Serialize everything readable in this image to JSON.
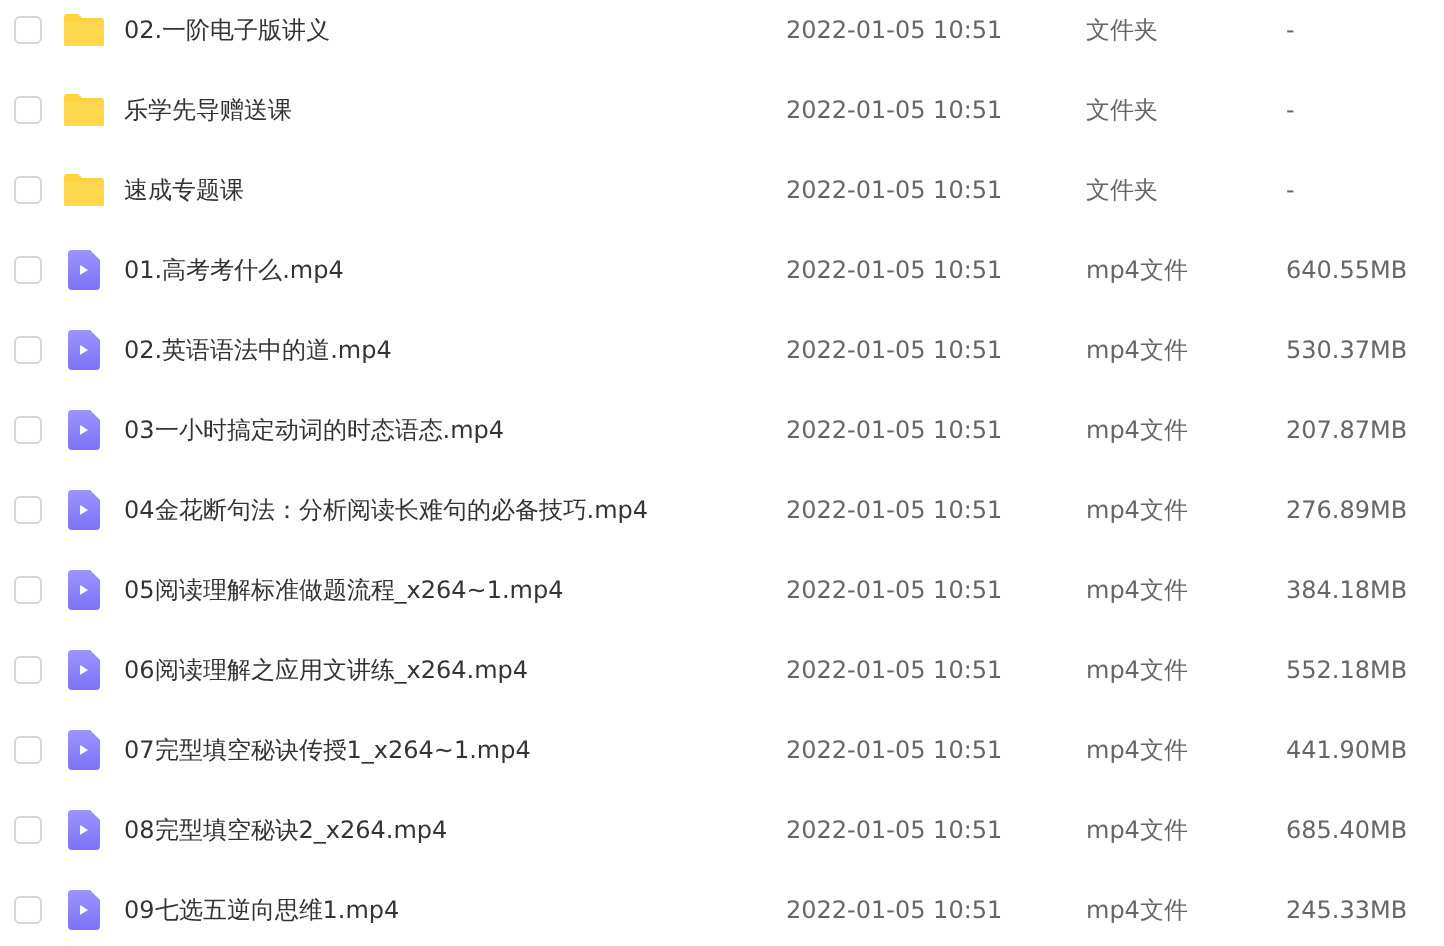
{
  "files": [
    {
      "kind": "folder",
      "checked": false,
      "name": "02.一阶电子版讲义",
      "modified": "2022-01-05 10:51",
      "type": "文件夹",
      "size": "-"
    },
    {
      "kind": "folder",
      "checked": false,
      "name": "乐学先导赠送课",
      "modified": "2022-01-05 10:51",
      "type": "文件夹",
      "size": "-"
    },
    {
      "kind": "folder",
      "checked": false,
      "name": "速成专题课",
      "modified": "2022-01-05 10:51",
      "type": "文件夹",
      "size": "-"
    },
    {
      "kind": "video",
      "checked": false,
      "name": "01.高考考什么.mp4",
      "modified": "2022-01-05 10:51",
      "type": "mp4文件",
      "size": "640.55MB"
    },
    {
      "kind": "video",
      "checked": false,
      "name": "02.英语语法中的道.mp4",
      "modified": "2022-01-05 10:51",
      "type": "mp4文件",
      "size": "530.37MB"
    },
    {
      "kind": "video",
      "checked": false,
      "name": "03一小时搞定动词的时态语态.mp4",
      "modified": "2022-01-05 10:51",
      "type": "mp4文件",
      "size": "207.87MB"
    },
    {
      "kind": "video",
      "checked": false,
      "name": "04金花断句法：分析阅读长难句的必备技巧.mp4",
      "modified": "2022-01-05 10:51",
      "type": "mp4文件",
      "size": "276.89MB"
    },
    {
      "kind": "video",
      "checked": false,
      "name": "05阅读理解标准做题流程_x264~1.mp4",
      "modified": "2022-01-05 10:51",
      "type": "mp4文件",
      "size": "384.18MB"
    },
    {
      "kind": "video",
      "checked": false,
      "name": "06阅读理解之应用文讲练_x264.mp4",
      "modified": "2022-01-05 10:51",
      "type": "mp4文件",
      "size": "552.18MB"
    },
    {
      "kind": "video",
      "checked": false,
      "name": "07完型填空秘诀传授1_x264~1.mp4",
      "modified": "2022-01-05 10:51",
      "type": "mp4文件",
      "size": "441.90MB"
    },
    {
      "kind": "video",
      "checked": false,
      "name": "08完型填空秘诀2_x264.mp4",
      "modified": "2022-01-05 10:51",
      "type": "mp4文件",
      "size": "685.40MB"
    },
    {
      "kind": "video",
      "checked": false,
      "name": "09七选五逆向思维1.mp4",
      "modified": "2022-01-05 10:51",
      "type": "mp4文件",
      "size": "245.33MB"
    }
  ]
}
